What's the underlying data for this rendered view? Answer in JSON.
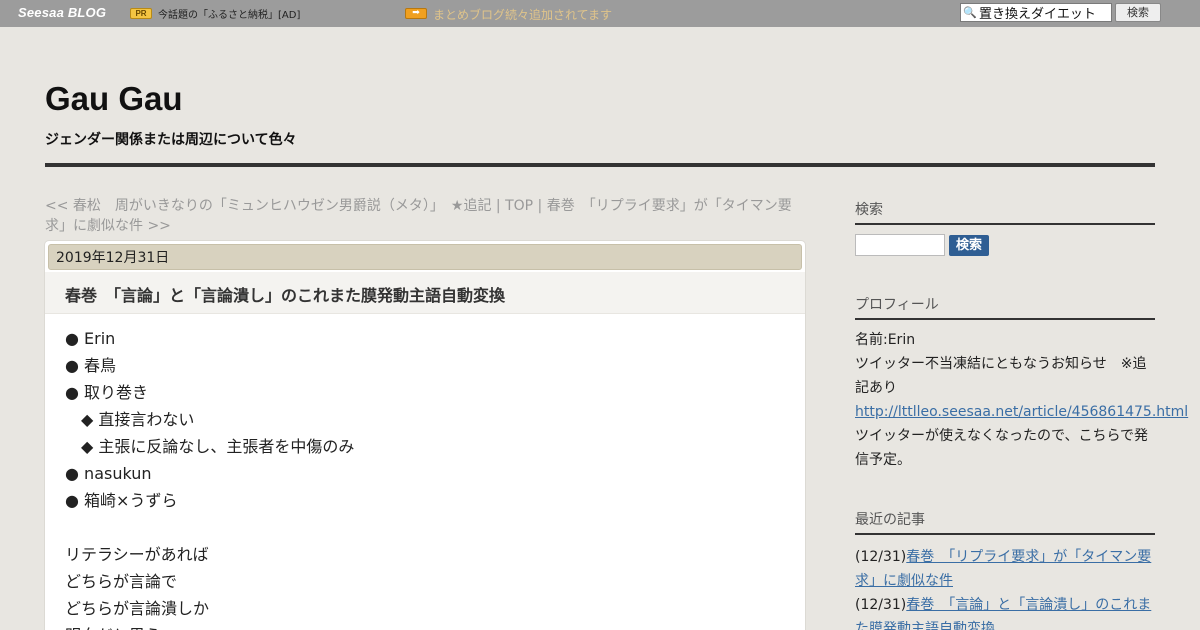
{
  "topbar": {
    "logo": "Seesaa BLOG",
    "pr_badge": "PR",
    "pr_text": "今話題の「ふるさと納税」[AD]",
    "arrow_badge": "➡",
    "promo_link": "まとめブログ続々追加されてます",
    "search_value": "置き換えダイエット",
    "search_button": "検索"
  },
  "header": {
    "title": "Gau Gau",
    "subtitle": "ジェンダー関係または周辺について色々"
  },
  "topic_path": {
    "prev": "<< 春松　周がいきなりの「ミュンヒハウゼン男爵説（メタ）」　★追記",
    "sep1": " | ",
    "top": "TOP",
    "sep2": " | ",
    "next": "春巻　「リプライ要求」が「タイマン要求」に劇似な件 >>"
  },
  "article": {
    "date": "2019年12月31日",
    "title": "春巻　「言論」と「言論潰し」のこれまた膜発動主語自動変換",
    "lines": [
      "● Erin",
      "● 春鳥",
      "● 取り巻き",
      "◆ 直接言わない",
      "◆ 主張に反論なし、主張者を中傷のみ",
      "● nasukun",
      "● 箱崎×うずら",
      "",
      "リテラシーがあれば",
      "どちらが言論で",
      "どちらが言論潰しか",
      "明白だと思う"
    ]
  },
  "sidebar": {
    "search_heading": "検索",
    "search_button": "検索",
    "profile_heading": "プロフィール",
    "profile_name": "名前:Erin",
    "profile_notice_1": "ツイッター不当凍結にともなうお知らせ　※追",
    "profile_notice_2": "記あり",
    "profile_link": "http://lttlleo.seesaa.net/article/456861475.html",
    "profile_after_1": "ツイッターが使えなくなったので、こちらで発",
    "profile_after_2": "信予定。",
    "recent_heading": "最近の記事",
    "recent": [
      {
        "date": "(12/31)",
        "title_1": "春巻　「リプライ要求」が「タイマン要",
        "title_2": "求」に劇似な件"
      },
      {
        "date": "(12/31)",
        "title_1": "春巻　「言論」と「言論潰し」のこれま",
        "title_2": "た膜発動主語自動変換"
      }
    ]
  }
}
